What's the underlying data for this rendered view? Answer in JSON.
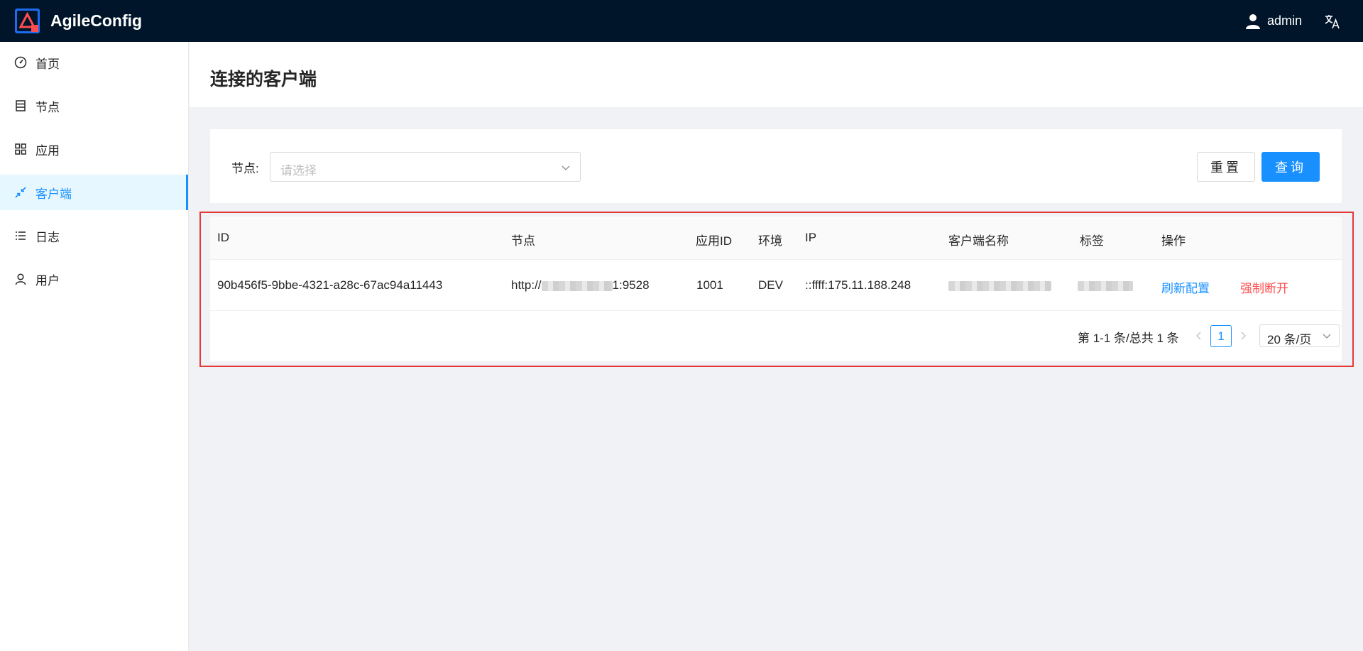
{
  "app": {
    "title": "AgileConfig"
  },
  "header": {
    "user": "admin",
    "language_icon": "translate-icon"
  },
  "sidebar": {
    "items": [
      {
        "label": "首页",
        "icon": "dashboard-icon"
      },
      {
        "label": "节点",
        "icon": "node-list-icon"
      },
      {
        "label": "应用",
        "icon": "apps-grid-icon"
      },
      {
        "label": "客户端",
        "icon": "shrink-icon",
        "active": true
      },
      {
        "label": "日志",
        "icon": "log-list-icon"
      },
      {
        "label": "用户",
        "icon": "user-icon"
      }
    ]
  },
  "page": {
    "title": "连接的客户端"
  },
  "search": {
    "node_label": "节点:",
    "node_placeholder": "请选择",
    "reset_label": "重置",
    "query_label": "查询"
  },
  "table": {
    "columns": [
      "ID",
      "节点",
      "应用ID",
      "环境",
      "IP",
      "客户端名称",
      "标签",
      "操作"
    ],
    "rows": [
      {
        "id": "90b456f5-9bbe-4321-a28c-67ac94a11443",
        "node_prefix": "http://",
        "node_suffix": "1:9528",
        "app_id": "1001",
        "env": "DEV",
        "ip": "::ffff:175.11.188.248",
        "client_name": "",
        "tag": "",
        "actions": [
          "刷新配置",
          "强制断开"
        ]
      }
    ]
  },
  "pagination": {
    "total_text": "第 1-1 条/总共 1 条",
    "current_page": "1",
    "page_size": "20 条/页"
  },
  "colors": {
    "primary": "#1890ff",
    "danger": "#ff4d4f",
    "header_bg": "#001529",
    "highlight": "#e53935"
  }
}
